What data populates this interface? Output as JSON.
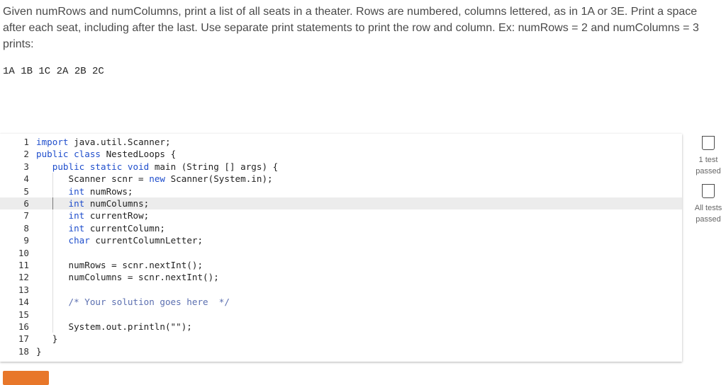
{
  "prompt": "Given numRows and numColumns, print a list of all seats in a theater. Rows are numbered, columns lettered, as in 1A or 3E. Print a space after each seat, including after the last. Use separate print statements to print the row and column. Ex: numRows = 2 and numColumns = 3 prints:",
  "example_output": "1A 1B 1C 2A 2B 2C",
  "editor": {
    "lines": [
      {
        "n": "1",
        "parts": [
          {
            "t": "import",
            "c": "kw"
          },
          {
            "t": " java.util.Scanner;",
            "c": ""
          }
        ]
      },
      {
        "n": "2",
        "parts": [
          {
            "t": "public class",
            "c": "kw"
          },
          {
            "t": " NestedLoops {",
            "c": ""
          }
        ]
      },
      {
        "n": "3",
        "parts": [
          {
            "t": "   ",
            "c": ""
          },
          {
            "t": "public static void",
            "c": "kw"
          },
          {
            "t": " main (String [] args) {",
            "c": ""
          }
        ]
      },
      {
        "n": "4",
        "parts": [
          {
            "t": "      Scanner scnr = ",
            "c": ""
          },
          {
            "t": "new",
            "c": "kw"
          },
          {
            "t": " Scanner(System.in);",
            "c": ""
          }
        ]
      },
      {
        "n": "5",
        "parts": [
          {
            "t": "      ",
            "c": ""
          },
          {
            "t": "int",
            "c": "kw"
          },
          {
            "t": " numRows;",
            "c": ""
          }
        ]
      },
      {
        "n": "6",
        "parts": [
          {
            "t": "      ",
            "c": ""
          },
          {
            "t": "int",
            "c": "kw"
          },
          {
            "t": " numColumns;",
            "c": ""
          }
        ]
      },
      {
        "n": "7",
        "parts": [
          {
            "t": "      ",
            "c": ""
          },
          {
            "t": "int",
            "c": "kw"
          },
          {
            "t": " currentRow;",
            "c": ""
          }
        ]
      },
      {
        "n": "8",
        "parts": [
          {
            "t": "      ",
            "c": ""
          },
          {
            "t": "int",
            "c": "kw"
          },
          {
            "t": " currentColumn;",
            "c": ""
          }
        ]
      },
      {
        "n": "9",
        "parts": [
          {
            "t": "      ",
            "c": ""
          },
          {
            "t": "char",
            "c": "kw"
          },
          {
            "t": " currentColumnLetter;",
            "c": ""
          }
        ]
      },
      {
        "n": "10",
        "parts": []
      },
      {
        "n": "11",
        "parts": [
          {
            "t": "      numRows = scnr.nextInt();",
            "c": ""
          }
        ]
      },
      {
        "n": "12",
        "parts": [
          {
            "t": "      numColumns = scnr.nextInt();",
            "c": ""
          }
        ]
      },
      {
        "n": "13",
        "parts": []
      },
      {
        "n": "14",
        "parts": [
          {
            "t": "      ",
            "c": ""
          },
          {
            "t": "/* Your solution goes here  */",
            "c": "cm"
          }
        ]
      },
      {
        "n": "15",
        "parts": []
      },
      {
        "n": "16",
        "parts": [
          {
            "t": "      System.out.println(\"\");",
            "c": ""
          }
        ]
      },
      {
        "n": "17",
        "parts": [
          {
            "t": "   }",
            "c": ""
          }
        ]
      },
      {
        "n": "18",
        "parts": [
          {
            "t": "}",
            "c": ""
          }
        ]
      }
    ],
    "active_line": "6"
  },
  "tests": [
    {
      "label": "1 test passed",
      "icon": "checkbox-icon"
    },
    {
      "label": "All tests passed",
      "icon": "checkbox-icon"
    }
  ],
  "colors": {
    "accent": "#e8772a",
    "keyword": "#1f4ecc",
    "comment": "#5b6fb0",
    "active_line": "#ececec"
  }
}
